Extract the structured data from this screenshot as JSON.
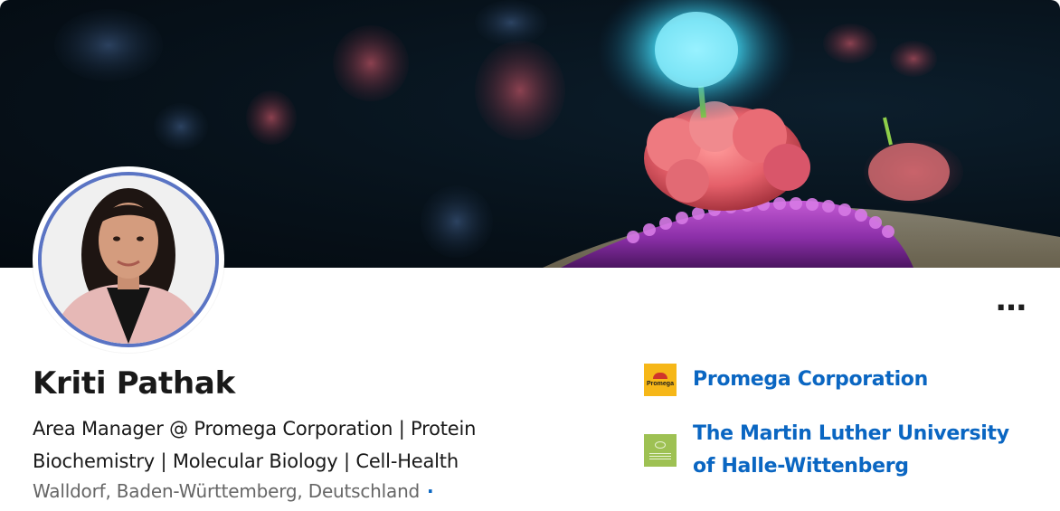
{
  "profile": {
    "name": "Kriti Pathak",
    "headline": "Area Manager @ Promega Corporation | Protein Biochemistry | Molecular Biology | Cell-Health",
    "location": "Walldorf, Baden-Württemberg, Deutschland",
    "location_separator": "·"
  },
  "actions": {
    "more_label": "…"
  },
  "organizations": [
    {
      "name": "Promega Corporation",
      "logo_text": "Promega",
      "logo_icon": "promega-logo"
    },
    {
      "name": "The Martin Luther University of Halle-Wittenberg",
      "logo_icon": "mlu-logo"
    }
  ],
  "colors": {
    "link_blue": "#0a66c2",
    "avatar_ring": "#5a74c4",
    "promega_yellow": "#f6b718",
    "mlu_green": "#9ec153"
  }
}
